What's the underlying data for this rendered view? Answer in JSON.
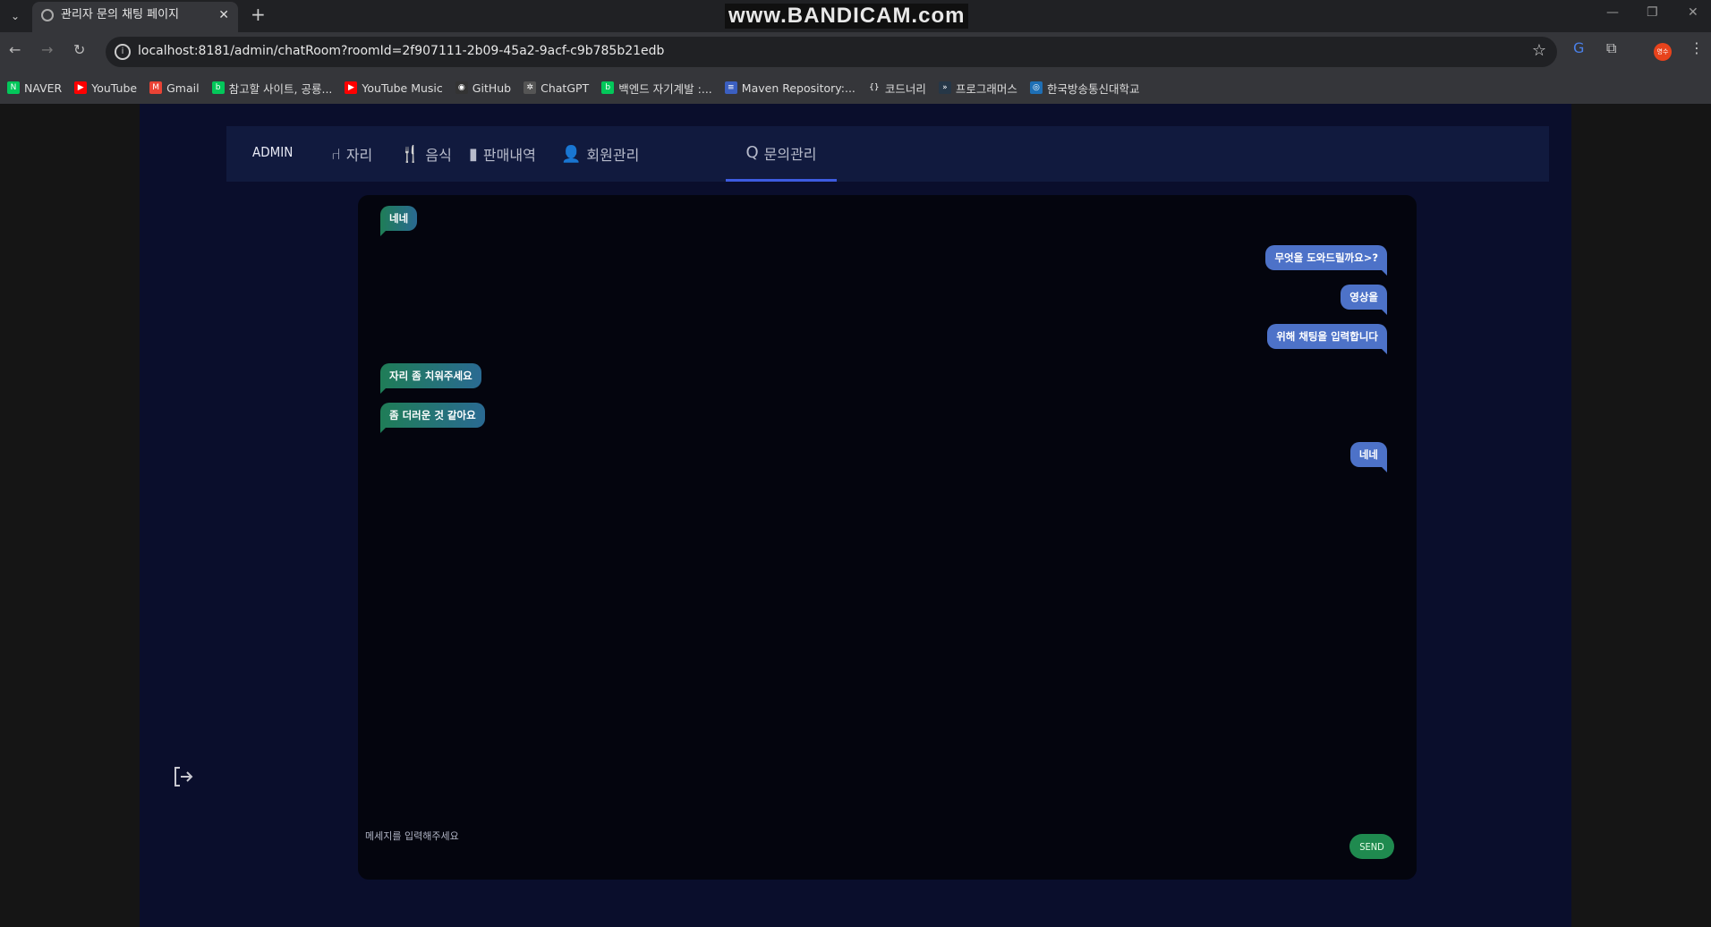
{
  "browser": {
    "tab_title": "관리자 문의 채팅 페이지",
    "watermark": "www.BANDICAM.com",
    "url": "localhost:8181/admin/chatRoom?roomId=2f907111-2b09-45a2-9acf-c9b785b21edb",
    "profile": "영수",
    "bookmarks": [
      {
        "label": "NAVER",
        "color": "#03c75a",
        "icon": "N"
      },
      {
        "label": "YouTube",
        "color": "#ff0000",
        "icon": "▶"
      },
      {
        "label": "Gmail",
        "color": "#ea4335",
        "icon": "M"
      },
      {
        "label": "참고할 사이트, 공룡...",
        "color": "#03c75a",
        "icon": "b"
      },
      {
        "label": "YouTube Music",
        "color": "#ff0000",
        "icon": "▶"
      },
      {
        "label": "GitHub",
        "color": "#333333",
        "icon": "◉"
      },
      {
        "label": "ChatGPT",
        "color": "#555555",
        "icon": "✲"
      },
      {
        "label": "백엔드 자기계발 :...",
        "color": "#03c75a",
        "icon": "b"
      },
      {
        "label": "Maven Repository:...",
        "color": "#3b5fc0",
        "icon": "≡"
      },
      {
        "label": "코드너리",
        "color": "#35363a",
        "icon": "{}"
      },
      {
        "label": "프로그래머스",
        "color": "#263747",
        "icon": "»"
      },
      {
        "label": "한국방송통신대학교",
        "color": "#1e6fb5",
        "icon": "◎"
      }
    ]
  },
  "navbar": {
    "brand": "ADMIN",
    "items": [
      {
        "label": "자리",
        "icon": "chair"
      },
      {
        "label": "음식",
        "icon": "utensils"
      },
      {
        "label": "판매내역",
        "icon": "chart"
      },
      {
        "label": "회원관리",
        "icon": "user"
      },
      {
        "label": "문의관리",
        "icon": "q",
        "active": true
      }
    ]
  },
  "chat": {
    "messages": [
      {
        "side": "left",
        "text": "네네"
      },
      {
        "side": "right",
        "text": "무엇을 도와드릴까요>?"
      },
      {
        "side": "right",
        "text": "영상을"
      },
      {
        "side": "right",
        "text": "위해 채팅을 입력합니다"
      },
      {
        "side": "left",
        "text": "자리 좀 치워주세요"
      },
      {
        "side": "left",
        "text": "좀 더러운 것 같아요"
      },
      {
        "side": "right",
        "text": "네네"
      }
    ],
    "input_placeholder": "메세지를 입력해주세요",
    "input_value": "",
    "send_label": "SEND"
  },
  "colors": {
    "accent": "#3d5be0",
    "send": "#1f8a4f",
    "bubble_right": "#4d72c8",
    "bubble_left": "#1f7d57"
  }
}
